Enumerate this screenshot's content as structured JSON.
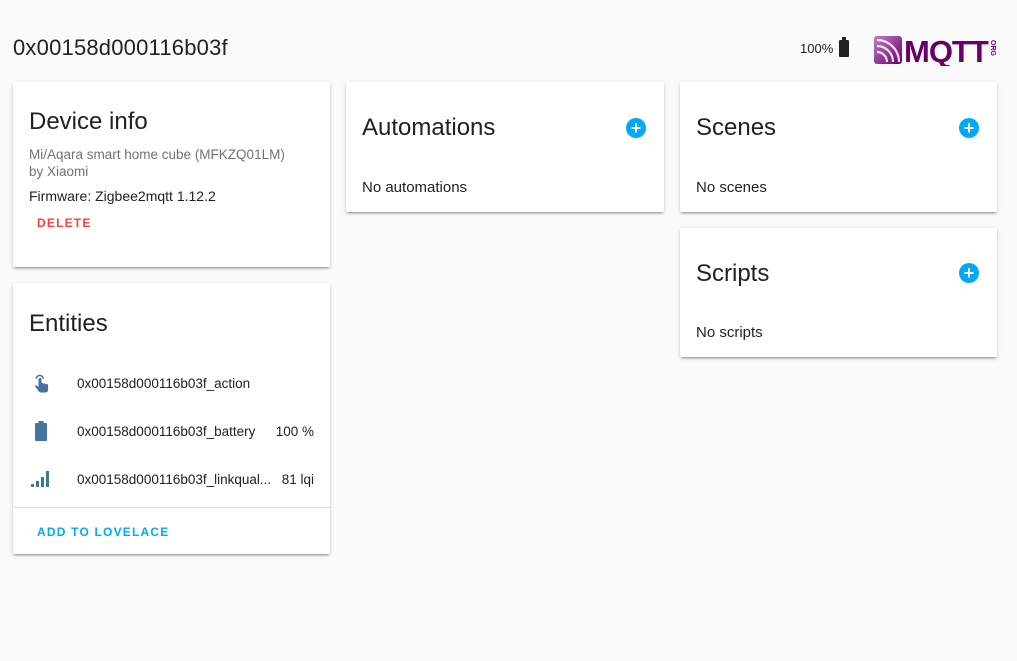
{
  "header": {
    "title": "0x00158d000116b03f",
    "battery_text": "100%",
    "logo_text": "MQTT",
    "logo_suffix": "ORG"
  },
  "device_info": {
    "title": "Device info",
    "model": "Mi/Aqara smart home cube (MFKZQ01LM)",
    "manufacturer": "by Xiaomi",
    "firmware": "Firmware: Zigbee2mqtt 1.12.2",
    "delete_label": "DELETE"
  },
  "entities": {
    "title": "Entities",
    "items": [
      {
        "icon": "gesture-tap-icon",
        "name": "0x00158d000116b03f_action",
        "state": ""
      },
      {
        "icon": "battery-icon",
        "name": "0x00158d000116b03f_battery",
        "state": "100 %"
      },
      {
        "icon": "signal-icon",
        "name": "0x00158d000116b03f_linkqual...",
        "state": "81 lqi"
      }
    ],
    "add_label": "ADD TO LOVELACE"
  },
  "automations": {
    "title": "Automations",
    "empty_text": "No automations"
  },
  "scenes": {
    "title": "Scenes",
    "empty_text": "No scenes"
  },
  "scripts": {
    "title": "Scripts",
    "empty_text": "No scripts"
  },
  "colors": {
    "accent": "#03a9f4",
    "danger": "#f44336",
    "icon": "#44739e",
    "logo": "#660066"
  }
}
